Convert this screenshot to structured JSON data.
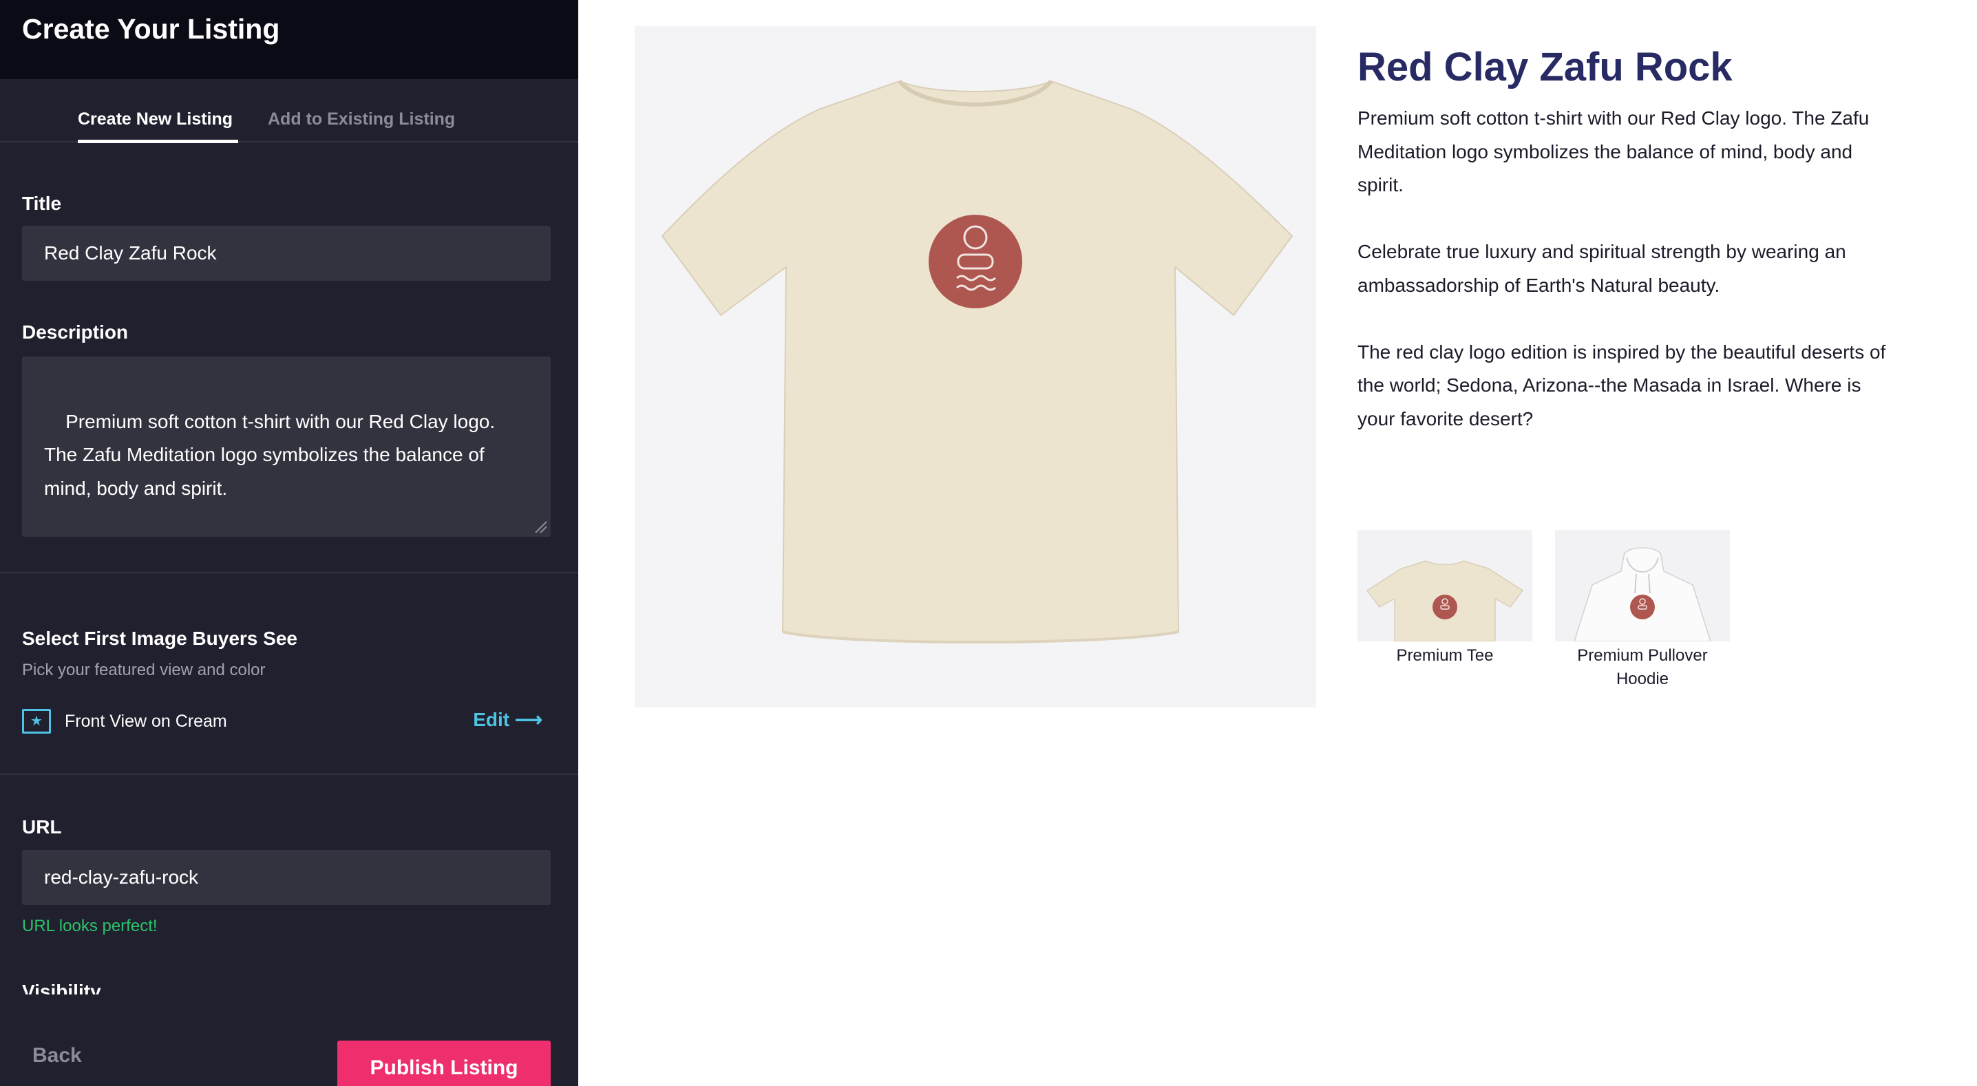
{
  "sidebar": {
    "header_title": "Create Your Listing",
    "tabs": [
      {
        "label": "Create New Listing",
        "active": true
      },
      {
        "label": "Add to Existing Listing",
        "active": false
      }
    ],
    "title_label": "Title",
    "title_value": "Red Clay Zafu Rock",
    "description_label": "Description",
    "description_value": "Premium soft cotton t-shirt with our Red Clay logo. The Zafu Meditation logo symbolizes the balance of mind, body and spirit.\n\nCelebrate true luxury and spiritual strength by",
    "first_image_heading": "Select First Image Buyers See",
    "first_image_sub": "Pick your featured view and color",
    "featured_view": "Front View on Cream",
    "edit_label": "Edit ⟶",
    "url_label": "URL",
    "url_value": "red-clay-zafu-rock",
    "url_status": "URL looks perfect!",
    "visibility_label": "Visibility",
    "back_label": "Back",
    "publish_label": "Publish Listing"
  },
  "preview": {
    "title": "Red Clay Zafu Rock",
    "description": [
      "Premium soft cotton t-shirt with our Red Clay logo. The Zafu Meditation logo symbolizes the balance of mind, body and spirit.",
      "Celebrate true luxury and spiritual strength by wearing an ambassadorship of Earth's Natural beauty.",
      "The red clay logo edition is inspired by the beautiful deserts of the world; Sedona, Arizona--the Masada in Israel. Where is your favorite desert?"
    ],
    "products": [
      {
        "label": "Premium Tee"
      },
      {
        "label": "Premium Pullover Hoodie"
      }
    ]
  },
  "colors": {
    "sidebar_bg": "#20202f",
    "header_bg": "#0b0b16",
    "field_bg": "#33333f",
    "accent_link": "#4fc3e3",
    "publish_bg": "#ef2e6e",
    "success": "#2bc46a",
    "title_navy": "#272a63",
    "shirt_cream": "#ede4cf",
    "logo_red": "#ae5650"
  }
}
